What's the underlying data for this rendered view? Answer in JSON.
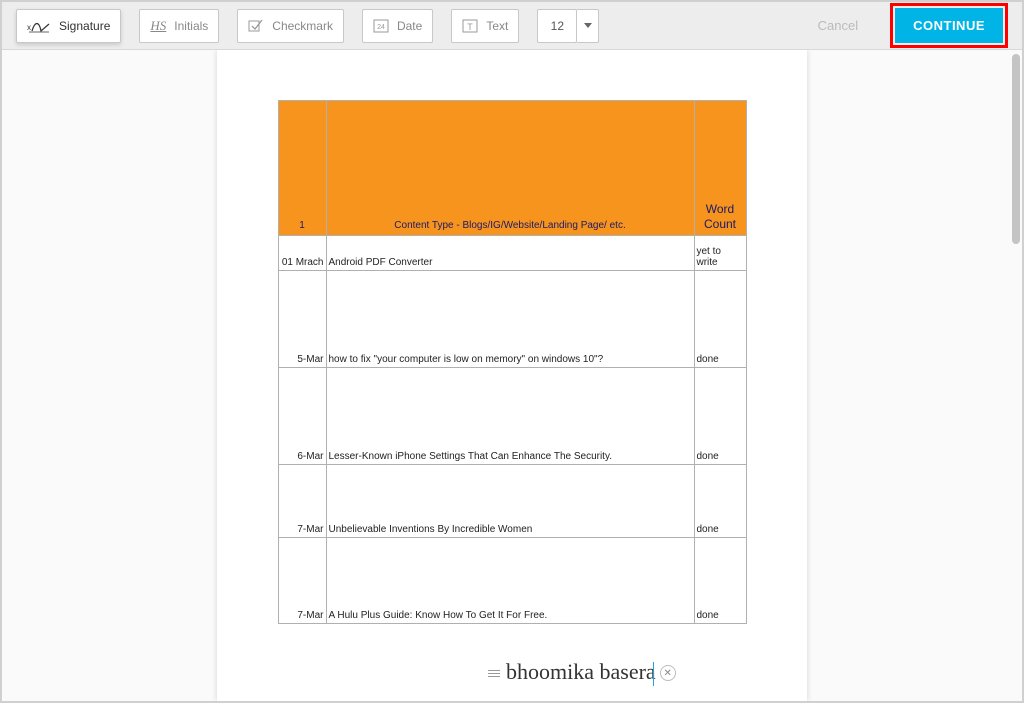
{
  "toolbar": {
    "signature_label": "Signature",
    "initials_label": "Initials",
    "initials_glyph": "HS",
    "checkmark_label": "Checkmark",
    "date_label": "Date",
    "date_glyph": "24",
    "text_label": "Text",
    "text_glyph": "T",
    "font_size": "12",
    "cancel_label": "Cancel",
    "continue_label": "CONTINUE"
  },
  "table": {
    "header": {
      "col1": "1",
      "col2": "Content Type - Blogs/IG/Website/Landing Page/ etc.",
      "col3": "Word Count"
    },
    "rows": [
      {
        "date": "01 Mrach",
        "title": "Android PDF Converter",
        "status": "yet to write"
      },
      {
        "date": "5-Mar",
        "title": "how to fix \"your computer is low on memory\" on windows 10\"?",
        "status": "done"
      },
      {
        "date": "6-Mar",
        "title": "Lesser-Known iPhone Settings That Can Enhance The Security.",
        "status": "done"
      },
      {
        "date": "7-Mar",
        "title": "Unbelievable Inventions By Incredible Women",
        "status": "done"
      },
      {
        "date": "7-Mar",
        "title": "A Hulu Plus Guide: Know How To Get It For Free.",
        "status": "done"
      }
    ]
  },
  "signature_text": "bhoomika basera"
}
